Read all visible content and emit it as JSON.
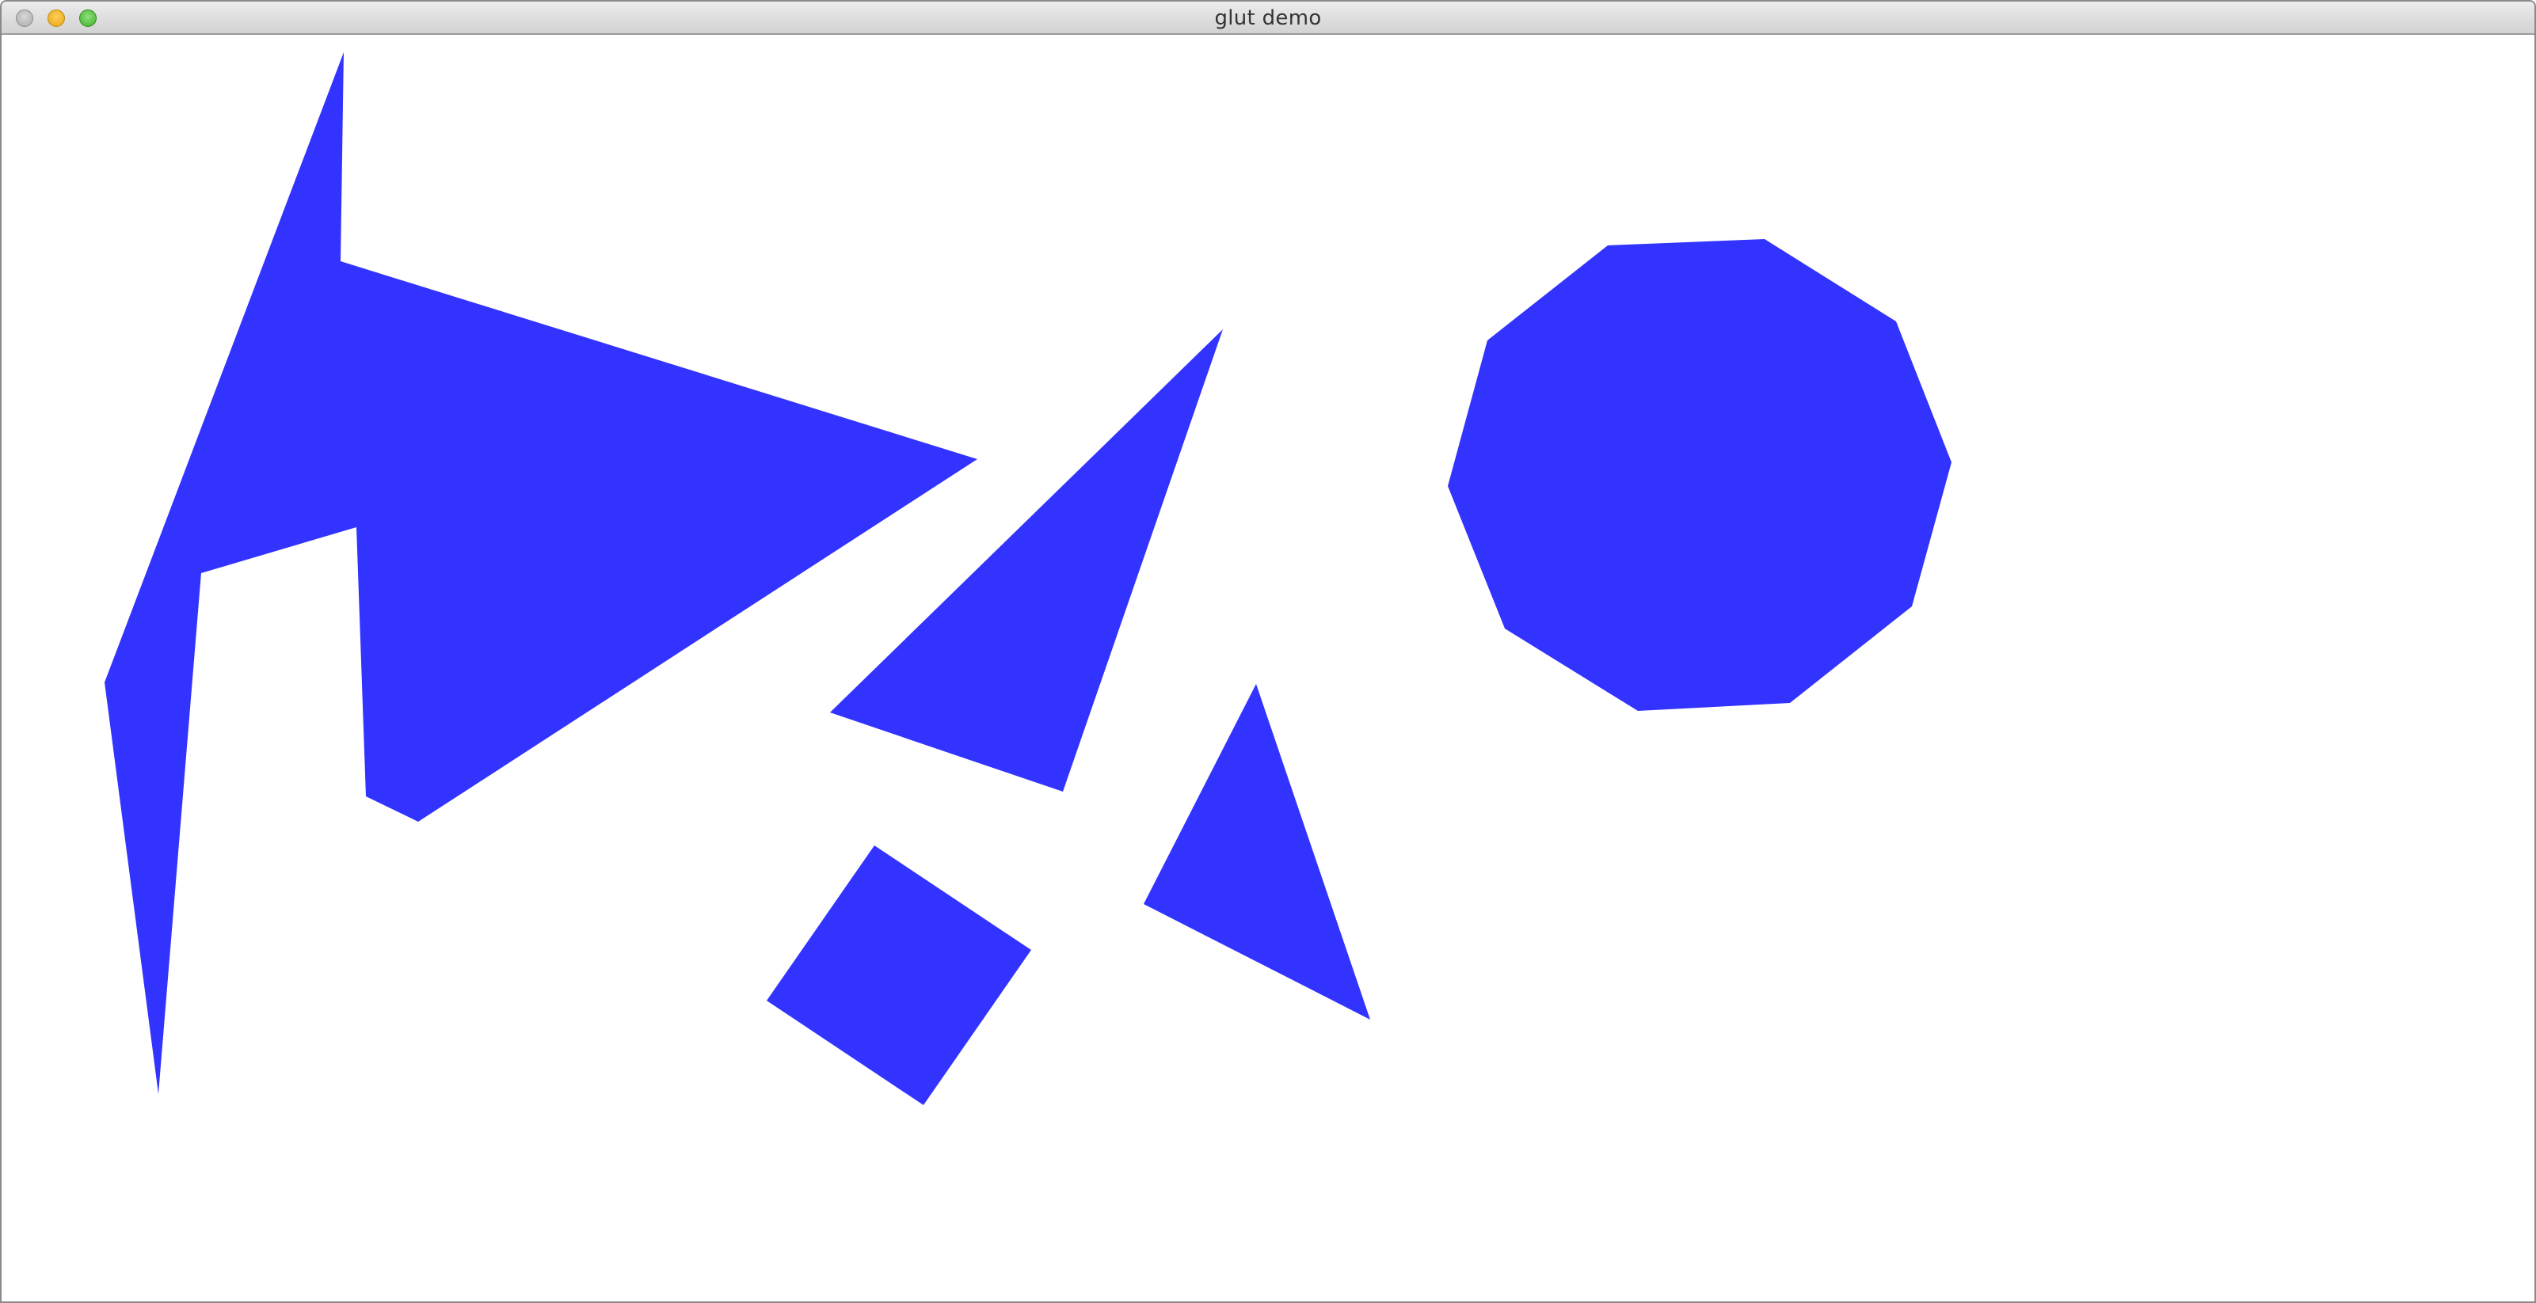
{
  "window": {
    "title": "glut demo"
  },
  "canvas": {
    "background_color": "#ffffff",
    "fill_color": "#3333ff",
    "shapes": [
      {
        "name": "irregular-polygon-shape",
        "kind": "polygon"
      },
      {
        "name": "large-triangle-shape",
        "kind": "triangle"
      },
      {
        "name": "square-shape",
        "kind": "quad"
      },
      {
        "name": "small-triangle-shape",
        "kind": "triangle"
      },
      {
        "name": "octagon-shape",
        "kind": "polygon"
      }
    ]
  }
}
